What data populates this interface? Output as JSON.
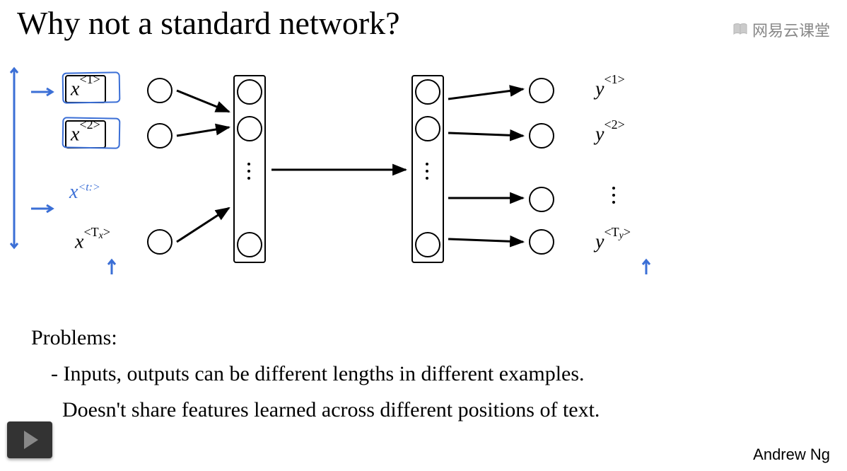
{
  "title": "Why not a standard network?",
  "watermark": "网易云课堂",
  "inputs": {
    "x1_sup": "<1>",
    "x2_sup": "<2>",
    "xt_hand": "x",
    "xt_hand_sup": "<t:>",
    "xTx_sup_prefix": "<T",
    "xTx_sup_sub": "x",
    "xTx_sup_suffix": ">"
  },
  "outputs": {
    "y1_sup": "<1>",
    "y2_sup": "<2>",
    "yTy_sup_prefix": "<T",
    "yTy_sup_sub": "y",
    "yTy_sup_suffix": ">"
  },
  "problems": {
    "hdr": "Problems:",
    "p1": "- Inputs, outputs can be different lengths in different examples.",
    "p2": "Doesn't share features learned across different positions of text."
  },
  "author": "Andrew Ng",
  "x_glyph": "x",
  "y_glyph": "y"
}
